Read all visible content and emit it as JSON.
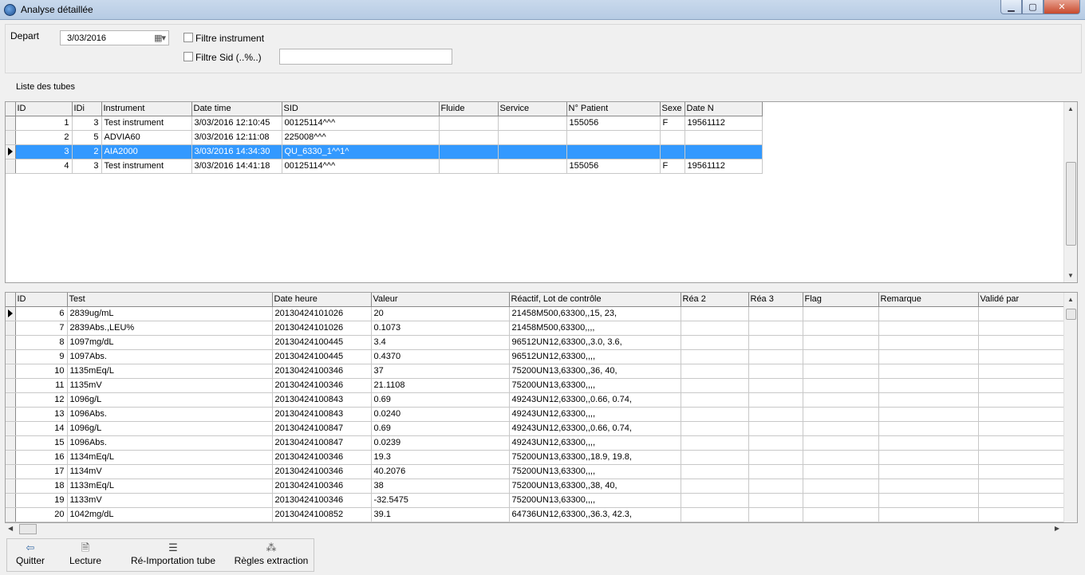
{
  "window": {
    "title": "Analyse détaillée",
    "min_glyph": "▁",
    "max_glyph": "▢",
    "close_glyph": "✕"
  },
  "filters": {
    "depart_label": "Depart",
    "depart_value": "3/03/2016",
    "filtre_instrument_label": "Filtre instrument",
    "filtre_sid_label": "Filtre Sid (..%..)",
    "filtre_sid_value": ""
  },
  "tubes": {
    "section_label": "Liste des tubes",
    "columns": [
      "ID",
      "IDi",
      "Instrument",
      "Date time",
      "SID",
      "Fluide",
      "Service",
      "N° Patient",
      "Sexe",
      "Date N"
    ],
    "rows": [
      [
        "1",
        "3",
        "Test instrument",
        "3/03/2016 12:10:45",
        "00125114^^^",
        "",
        "",
        "155056",
        "F",
        "19561112"
      ],
      [
        "2",
        "5",
        "ADVIA60",
        "3/03/2016 12:11:08",
        "225008^^^",
        "",
        "",
        "",
        "",
        ""
      ],
      [
        "3",
        "2",
        "AIA2000",
        "3/03/2016 14:34:30",
        "QU_6330_1^^1^",
        "",
        "",
        "",
        "",
        ""
      ],
      [
        "4",
        "3",
        "Test instrument",
        "3/03/2016 14:41:18",
        "00125114^^^",
        "",
        "",
        "155056",
        "F",
        "19561112"
      ]
    ],
    "selected_index": 2
  },
  "results": {
    "columns": [
      "ID",
      "Test",
      "Date heure",
      "Valeur",
      "Réactif, Lot de contrôle",
      "Réa 2",
      "Réa 3",
      "Flag",
      "Remarque",
      "Validé par"
    ],
    "rows": [
      [
        "6",
        "2839ug/mL",
        "20130424101026",
        "20",
        "21458M500,63300,,15, 23,"
      ],
      [
        "7",
        "2839Abs.,LEU%",
        "20130424101026",
        "0.1073",
        "21458M500,63300,,,,"
      ],
      [
        "8",
        "1097mg/dL",
        "20130424100445",
        "3.4",
        "96512UN12,63300,,3.0, 3.6,"
      ],
      [
        "9",
        "1097Abs.",
        "20130424100445",
        "0.4370",
        "96512UN12,63300,,,,"
      ],
      [
        "10",
        "1135mEq/L",
        "20130424100346",
        "37",
        "75200UN13,63300,,36, 40,"
      ],
      [
        "11",
        "1135mV",
        "20130424100346",
        "21.1108",
        "75200UN13,63300,,,,"
      ],
      [
        "12",
        "1096g/L",
        "20130424100843",
        "0.69",
        "49243UN12,63300,,0.66, 0.74,"
      ],
      [
        "13",
        "1096Abs.",
        "20130424100843",
        "0.0240",
        "49243UN12,63300,,,,"
      ],
      [
        "14",
        "1096g/L",
        "20130424100847",
        "0.69",
        "49243UN12,63300,,0.66, 0.74,"
      ],
      [
        "15",
        "1096Abs.",
        "20130424100847",
        "0.0239",
        "49243UN12,63300,,,,"
      ],
      [
        "16",
        "1134mEq/L",
        "20130424100346",
        "19.3",
        "75200UN13,63300,,18.9, 19.8,"
      ],
      [
        "17",
        "1134mV",
        "20130424100346",
        "40.2076",
        "75200UN13,63300,,,,"
      ],
      [
        "18",
        "1133mEq/L",
        "20130424100346",
        "38",
        "75200UN13,63300,,38, 40,"
      ],
      [
        "19",
        "1133mV",
        "20130424100346",
        "-32.5475",
        "75200UN13,63300,,,,"
      ],
      [
        "20",
        "1042mg/dL",
        "20130424100852",
        "39.1",
        "64736UN12,63300,,36.3, 42.3,"
      ]
    ],
    "selected_index": 0
  },
  "toolbar": {
    "quitter": "Quitter",
    "lecture": "Lecture",
    "reimport": "Ré-Importation tube",
    "regles": "Règles extraction"
  }
}
